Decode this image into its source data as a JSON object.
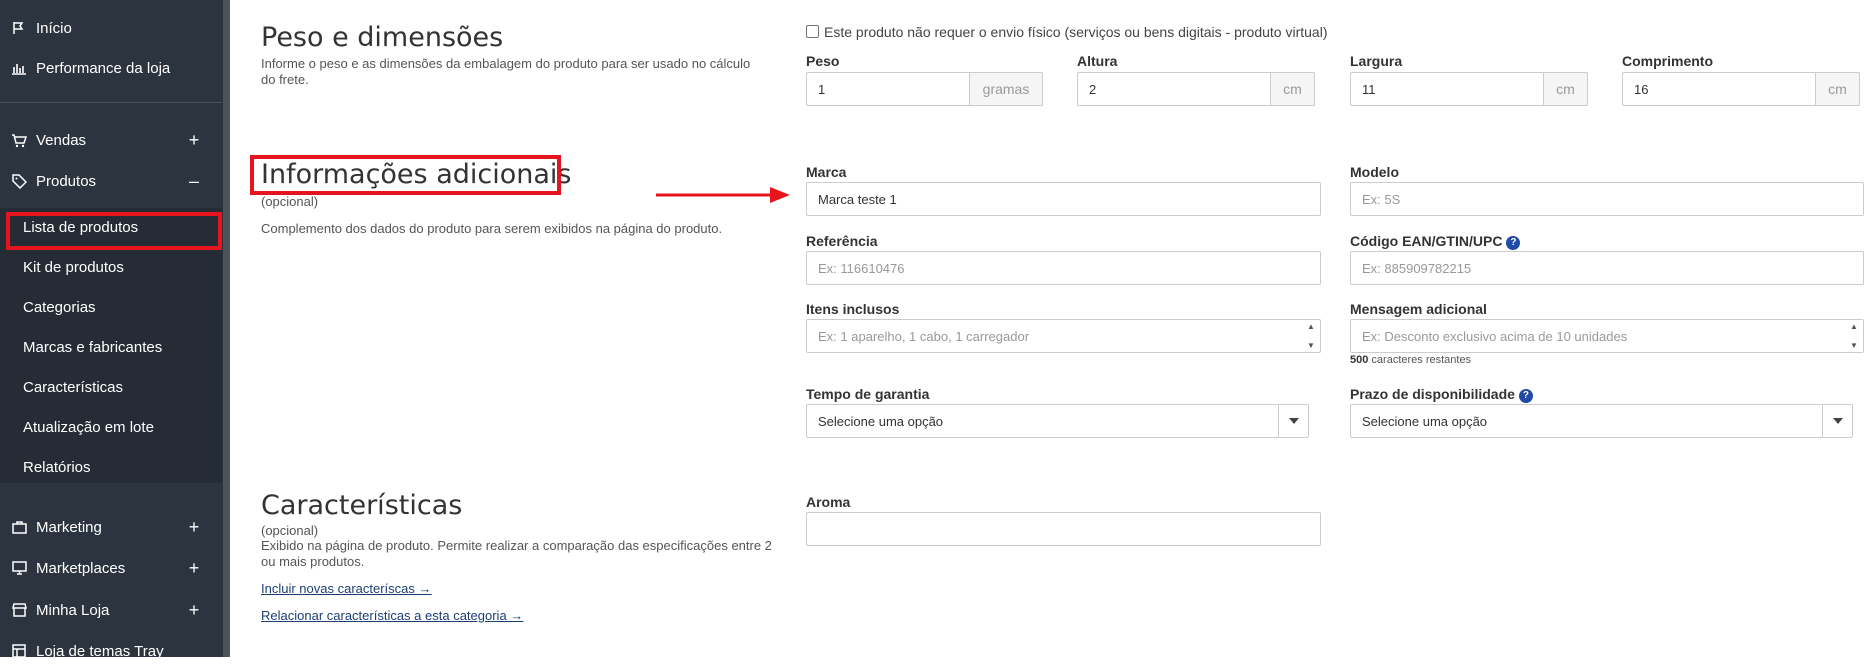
{
  "sidebar": {
    "top_items": [
      {
        "label": "Início",
        "icon": "flag-icon"
      },
      {
        "label": "Performance da loja",
        "icon": "bar-chart-icon"
      }
    ],
    "sections": [
      {
        "label": "Vendas",
        "icon": "cart-icon",
        "toggle": "+"
      },
      {
        "label": "Produtos",
        "icon": "tag-icon",
        "toggle": "–"
      }
    ],
    "product_sub_items": [
      "Lista de produtos",
      "Kit de produtos",
      "Categorias",
      "Marcas e fabricantes",
      "Características",
      "Atualização em lote",
      "Relatórios"
    ],
    "bottom_items": [
      {
        "label": "Marketing",
        "icon": "briefcase-icon",
        "toggle": "+"
      },
      {
        "label": "Marketplaces",
        "icon": "monitor-icon",
        "toggle": "+"
      },
      {
        "label": "Minha Loja",
        "icon": "store-icon",
        "toggle": "+"
      },
      {
        "label": "Loja de temas Tray",
        "icon": "layout-icon",
        "toggle": ""
      }
    ]
  },
  "weight_section": {
    "title": "Peso e dimensões",
    "description": "Informe o peso e as dimensões da embalagem do produto para ser usado no cálculo do frete.",
    "virtual_checkbox_label": "Este produto não requer o envio físico (serviços ou bens digitais - produto virtual)",
    "fields": [
      {
        "label": "Peso",
        "value": "1",
        "unit": "gramas"
      },
      {
        "label": "Altura",
        "value": "2",
        "unit": "cm"
      },
      {
        "label": "Largura",
        "value": "11",
        "unit": "cm"
      },
      {
        "label": "Comprimento",
        "value": "16",
        "unit": "cm"
      }
    ]
  },
  "extra_section": {
    "title": "Informações adicionais",
    "optional": "(opcional)",
    "description": "Complemento dos dados do produto para serem exibidos na página do produto.",
    "marca": {
      "label": "Marca",
      "value": "Marca teste 1"
    },
    "modelo": {
      "label": "Modelo",
      "placeholder": "Ex: 5S"
    },
    "referencia": {
      "label": "Referência",
      "placeholder": "Ex: 116610476"
    },
    "ean": {
      "label": "Código EAN/GTIN/UPC",
      "placeholder": "Ex: 885909782215"
    },
    "itens": {
      "label": "Itens inclusos",
      "placeholder": "Ex: 1 aparelho, 1 cabo, 1 carregador"
    },
    "mensagem": {
      "label": "Mensagem adicional",
      "placeholder": "Ex: Desconto exclusivo acima de 10 unidades"
    },
    "counter_number": "500",
    "counter_text": "caracteres restantes",
    "garantia": {
      "label": "Tempo de garantia",
      "value": "Selecione uma opção"
    },
    "prazo": {
      "label": "Prazo de disponibilidade",
      "value": "Selecione uma opção"
    }
  },
  "features_section": {
    "title": "Características",
    "optional": "(opcional)",
    "description": "Exibido na página de produto. Permite realizar a comparação das especificações entre 2 ou mais produtos.",
    "link_new": "Incluir novas caracteríscas →",
    "link_relate": "Relacionar características a esta categoria →",
    "aroma": {
      "label": "Aroma",
      "value": ""
    }
  },
  "colors": {
    "highlight": "#e8141d",
    "sidebar": "#2c3440",
    "help": "#1f4aa8"
  }
}
